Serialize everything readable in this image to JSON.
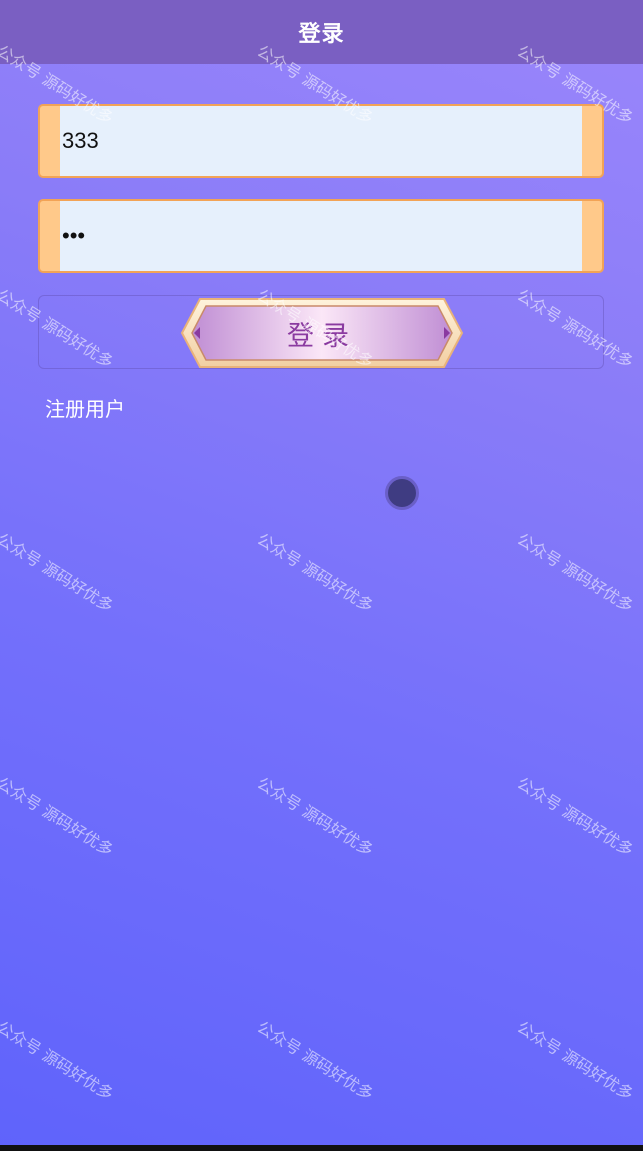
{
  "header": {
    "title": "登录"
  },
  "form": {
    "username_value": "333",
    "password_value": "333",
    "login_label": "登录",
    "register_label": "注册用户"
  },
  "watermark": {
    "text": "公众号 源码好优多"
  },
  "colors": {
    "header_bg": "#7a5fc2",
    "field_border": "#f2a356",
    "field_bg": "#e6f0fc",
    "button_text": "#8a3aa0",
    "loading_dot": "#3f3c82"
  },
  "icons": [
    "loading-spinner-icon"
  ]
}
